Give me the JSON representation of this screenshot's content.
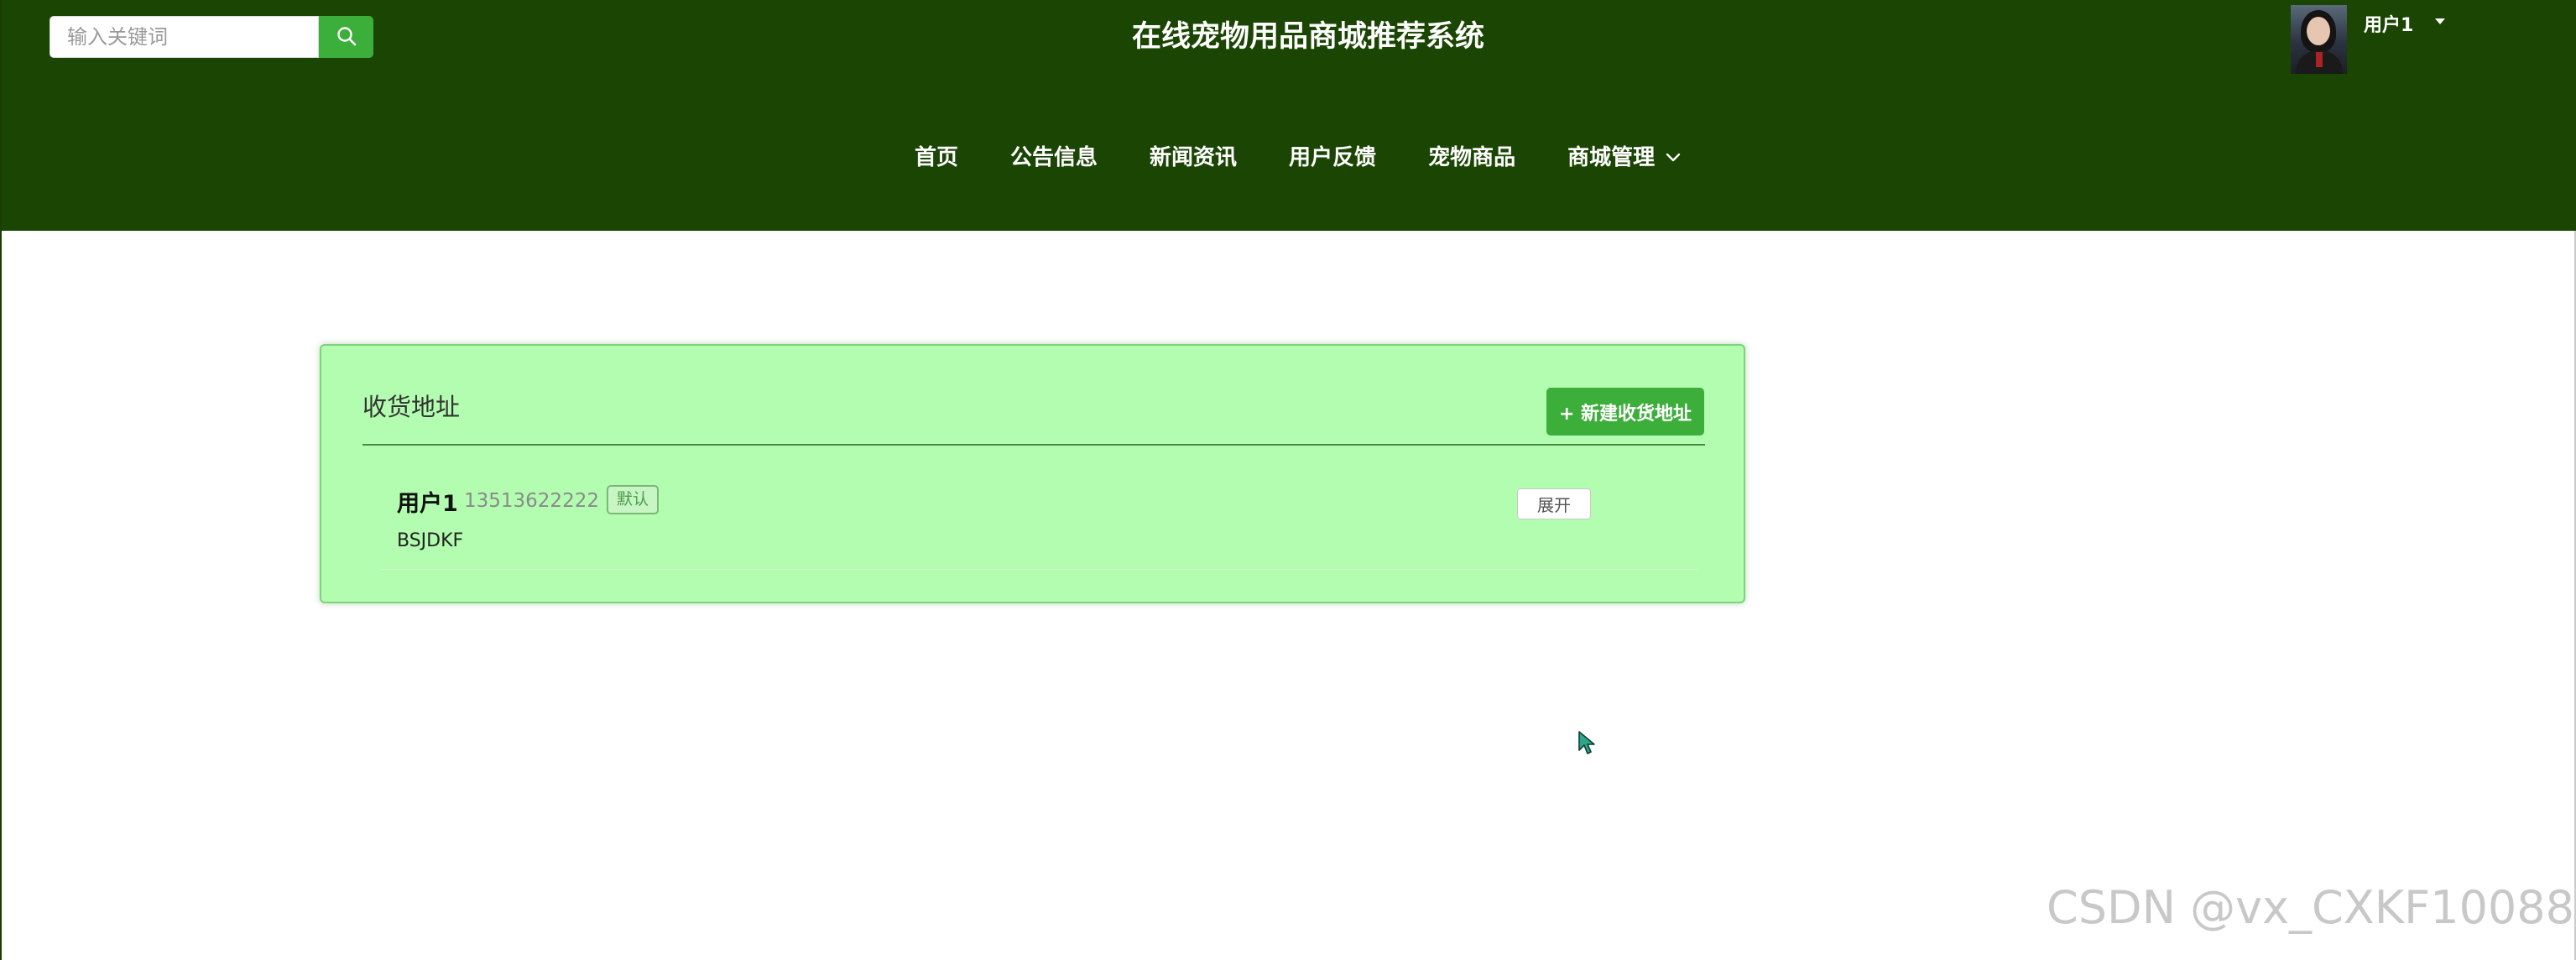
{
  "search": {
    "placeholder": "输入关键词"
  },
  "header": {
    "title": "在线宠物用品商城推荐系统",
    "user_name": "用户1"
  },
  "nav": {
    "items": [
      {
        "label": "首页"
      },
      {
        "label": "公告信息"
      },
      {
        "label": "新闻资讯"
      },
      {
        "label": "用户反馈"
      },
      {
        "label": "宠物商品"
      },
      {
        "label": "商城管理"
      }
    ]
  },
  "address_panel": {
    "title": "收货地址",
    "new_button_label": "+ 新建收货地址",
    "items": [
      {
        "name": "用户1",
        "phone": "13513622222",
        "default_badge": "默认",
        "address": "BSJDKF",
        "expand_label": "展开"
      }
    ]
  },
  "watermark": {
    "text": "CSDN @vx_CXKF10088"
  },
  "colors": {
    "header_bg": "#1b4503",
    "accent_green": "#3cae3a",
    "card_bg": "#b3fdb1"
  }
}
